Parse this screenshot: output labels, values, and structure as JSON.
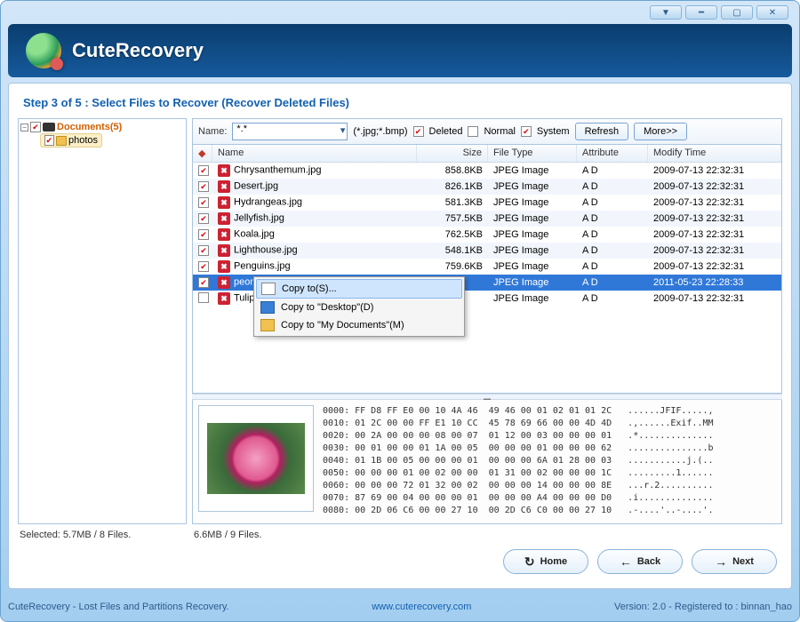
{
  "app": {
    "title": "CuteRecovery"
  },
  "step_title": "Step 3 of 5 : Select Files to Recover (Recover Deleted Files)",
  "tree": {
    "root": {
      "label": "Documents(5)",
      "expanded": true,
      "checked": true
    },
    "child": {
      "label": "photos",
      "checked": true
    }
  },
  "filter": {
    "name_label": "Name:",
    "pattern": "*.*",
    "ext_hint": "(*.jpg;*.bmp)",
    "deleted_label": "Deleted",
    "normal_label": "Normal",
    "system_label": "System",
    "deleted_checked": true,
    "normal_checked": false,
    "system_checked": true,
    "refresh": "Refresh",
    "more": "More>>"
  },
  "columns": {
    "name": "Name",
    "size": "Size",
    "type": "File Type",
    "attr": "Attribute",
    "time": "Modify Time"
  },
  "files": [
    {
      "chk": true,
      "name": "Chrysanthemum.jpg",
      "size": "858.8KB",
      "type": "JPEG Image",
      "attr": "A D",
      "time": "2009-07-13 22:32:31"
    },
    {
      "chk": true,
      "name": "Desert.jpg",
      "size": "826.1KB",
      "type": "JPEG Image",
      "attr": "A D",
      "time": "2009-07-13 22:32:31"
    },
    {
      "chk": true,
      "name": "Hydrangeas.jpg",
      "size": "581.3KB",
      "type": "JPEG Image",
      "attr": "A D",
      "time": "2009-07-13 22:32:31"
    },
    {
      "chk": true,
      "name": "Jellyfish.jpg",
      "size": "757.5KB",
      "type": "JPEG Image",
      "attr": "A D",
      "time": "2009-07-13 22:32:31"
    },
    {
      "chk": true,
      "name": "Koala.jpg",
      "size": "762.5KB",
      "type": "JPEG Image",
      "attr": "A D",
      "time": "2009-07-13 22:32:31"
    },
    {
      "chk": true,
      "name": "Lighthouse.jpg",
      "size": "548.1KB",
      "type": "JPEG Image",
      "attr": "A D",
      "time": "2009-07-13 22:32:31"
    },
    {
      "chk": true,
      "name": "Penguins.jpg",
      "size": "759.6KB",
      "type": "JPEG Image",
      "attr": "A D",
      "time": "2009-07-13 22:32:31"
    },
    {
      "chk": true,
      "name": "peony.jpg",
      "size": "",
      "type": "JPEG Image",
      "attr": "A D",
      "time": "2011-05-23 22:28:33",
      "selected": true
    },
    {
      "chk": false,
      "name": "Tulips.jpg",
      "size": "",
      "type": "JPEG Image",
      "attr": "A D",
      "time": "2009-07-13 22:32:31"
    }
  ],
  "context_menu": {
    "copy_to": "Copy to(S)...",
    "copy_desktop": "Copy to \"Desktop\"(D)",
    "copy_mydocs": "Copy to \"My Documents\"(M)"
  },
  "hex_lines": [
    "0000: FF D8 FF E0 00 10 4A 46  49 46 00 01 02 01 01 2C   ......JFIF.....,",
    "0010: 01 2C 00 00 FF E1 10 CC  45 78 69 66 00 00 4D 4D   .,......Exif..MM",
    "0020: 00 2A 00 00 00 08 00 07  01 12 00 03 00 00 00 01   .*..............",
    "0030: 00 01 00 00 01 1A 00 05  00 00 00 01 00 00 00 62   ...............b",
    "0040: 01 1B 00 05 00 00 00 01  00 00 00 6A 01 28 00 03   ...........j.(..",
    "0050: 00 00 00 01 00 02 00 00  01 31 00 02 00 00 00 1C   .........1......",
    "0060: 00 00 00 72 01 32 00 02  00 00 00 14 00 00 00 8E   ...r.2..........",
    "0070: 87 69 00 04 00 00 00 01  00 00 00 A4 00 00 00 D0   .i..............",
    "0080: 00 2D 06 C6 00 00 27 10  00 2D C6 C0 00 00 27 10   .-....'..-....'."
  ],
  "status": {
    "selected": "Selected: 5.7MB / 8 Files.",
    "total": "6.6MB / 9 Files."
  },
  "buttons": {
    "home": "Home",
    "back": "Back",
    "next": "Next"
  },
  "bottom": {
    "tagline": "CuteRecovery - Lost Files and Partitions Recovery.",
    "url": "www.cuterecovery.com",
    "version": "Version: 2.0 - Registered to : binnan_hao"
  }
}
